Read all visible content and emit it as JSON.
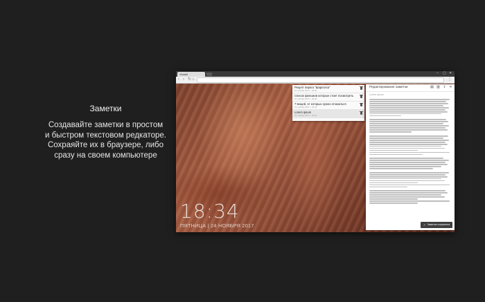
{
  "promo": {
    "title": "Заметки",
    "lines": [
      "Создавайте заметки в простом",
      "и быстром текстовом редкаторе.",
      "Сохраяйте их в браузере, либо",
      "сразу на своем компьютере"
    ]
  },
  "browser": {
    "tab_label": "Vivaldi",
    "widget": {
      "time": "18:34",
      "date": "ПЯТНИЦА | 24 НОЯБРЯ 2017"
    }
  },
  "notes": {
    "items": [
      {
        "title": "Рецепт пирога \"Шарлотка\"",
        "date": "24 ноября 2017 г. 18:34"
      },
      {
        "title": "Список фильмов которые стоит посмотреть",
        "date": "24 ноября 2017 г. 18:34"
      },
      {
        "title": "7 вещей, от которых нужно отказаться",
        "date": "24 ноября 2017 г. 18:34"
      },
      {
        "title": "Lorem ipsum",
        "date": "24 ноября 2017 г. 18:34"
      }
    ]
  },
  "editor": {
    "title": "Редактирование заметки",
    "note_heading": "Lorem ipsum",
    "save_label": "Заметка сохранена",
    "icons": [
      "save-file-icon",
      "delete-icon",
      "export-icon",
      "close-icon"
    ]
  }
}
